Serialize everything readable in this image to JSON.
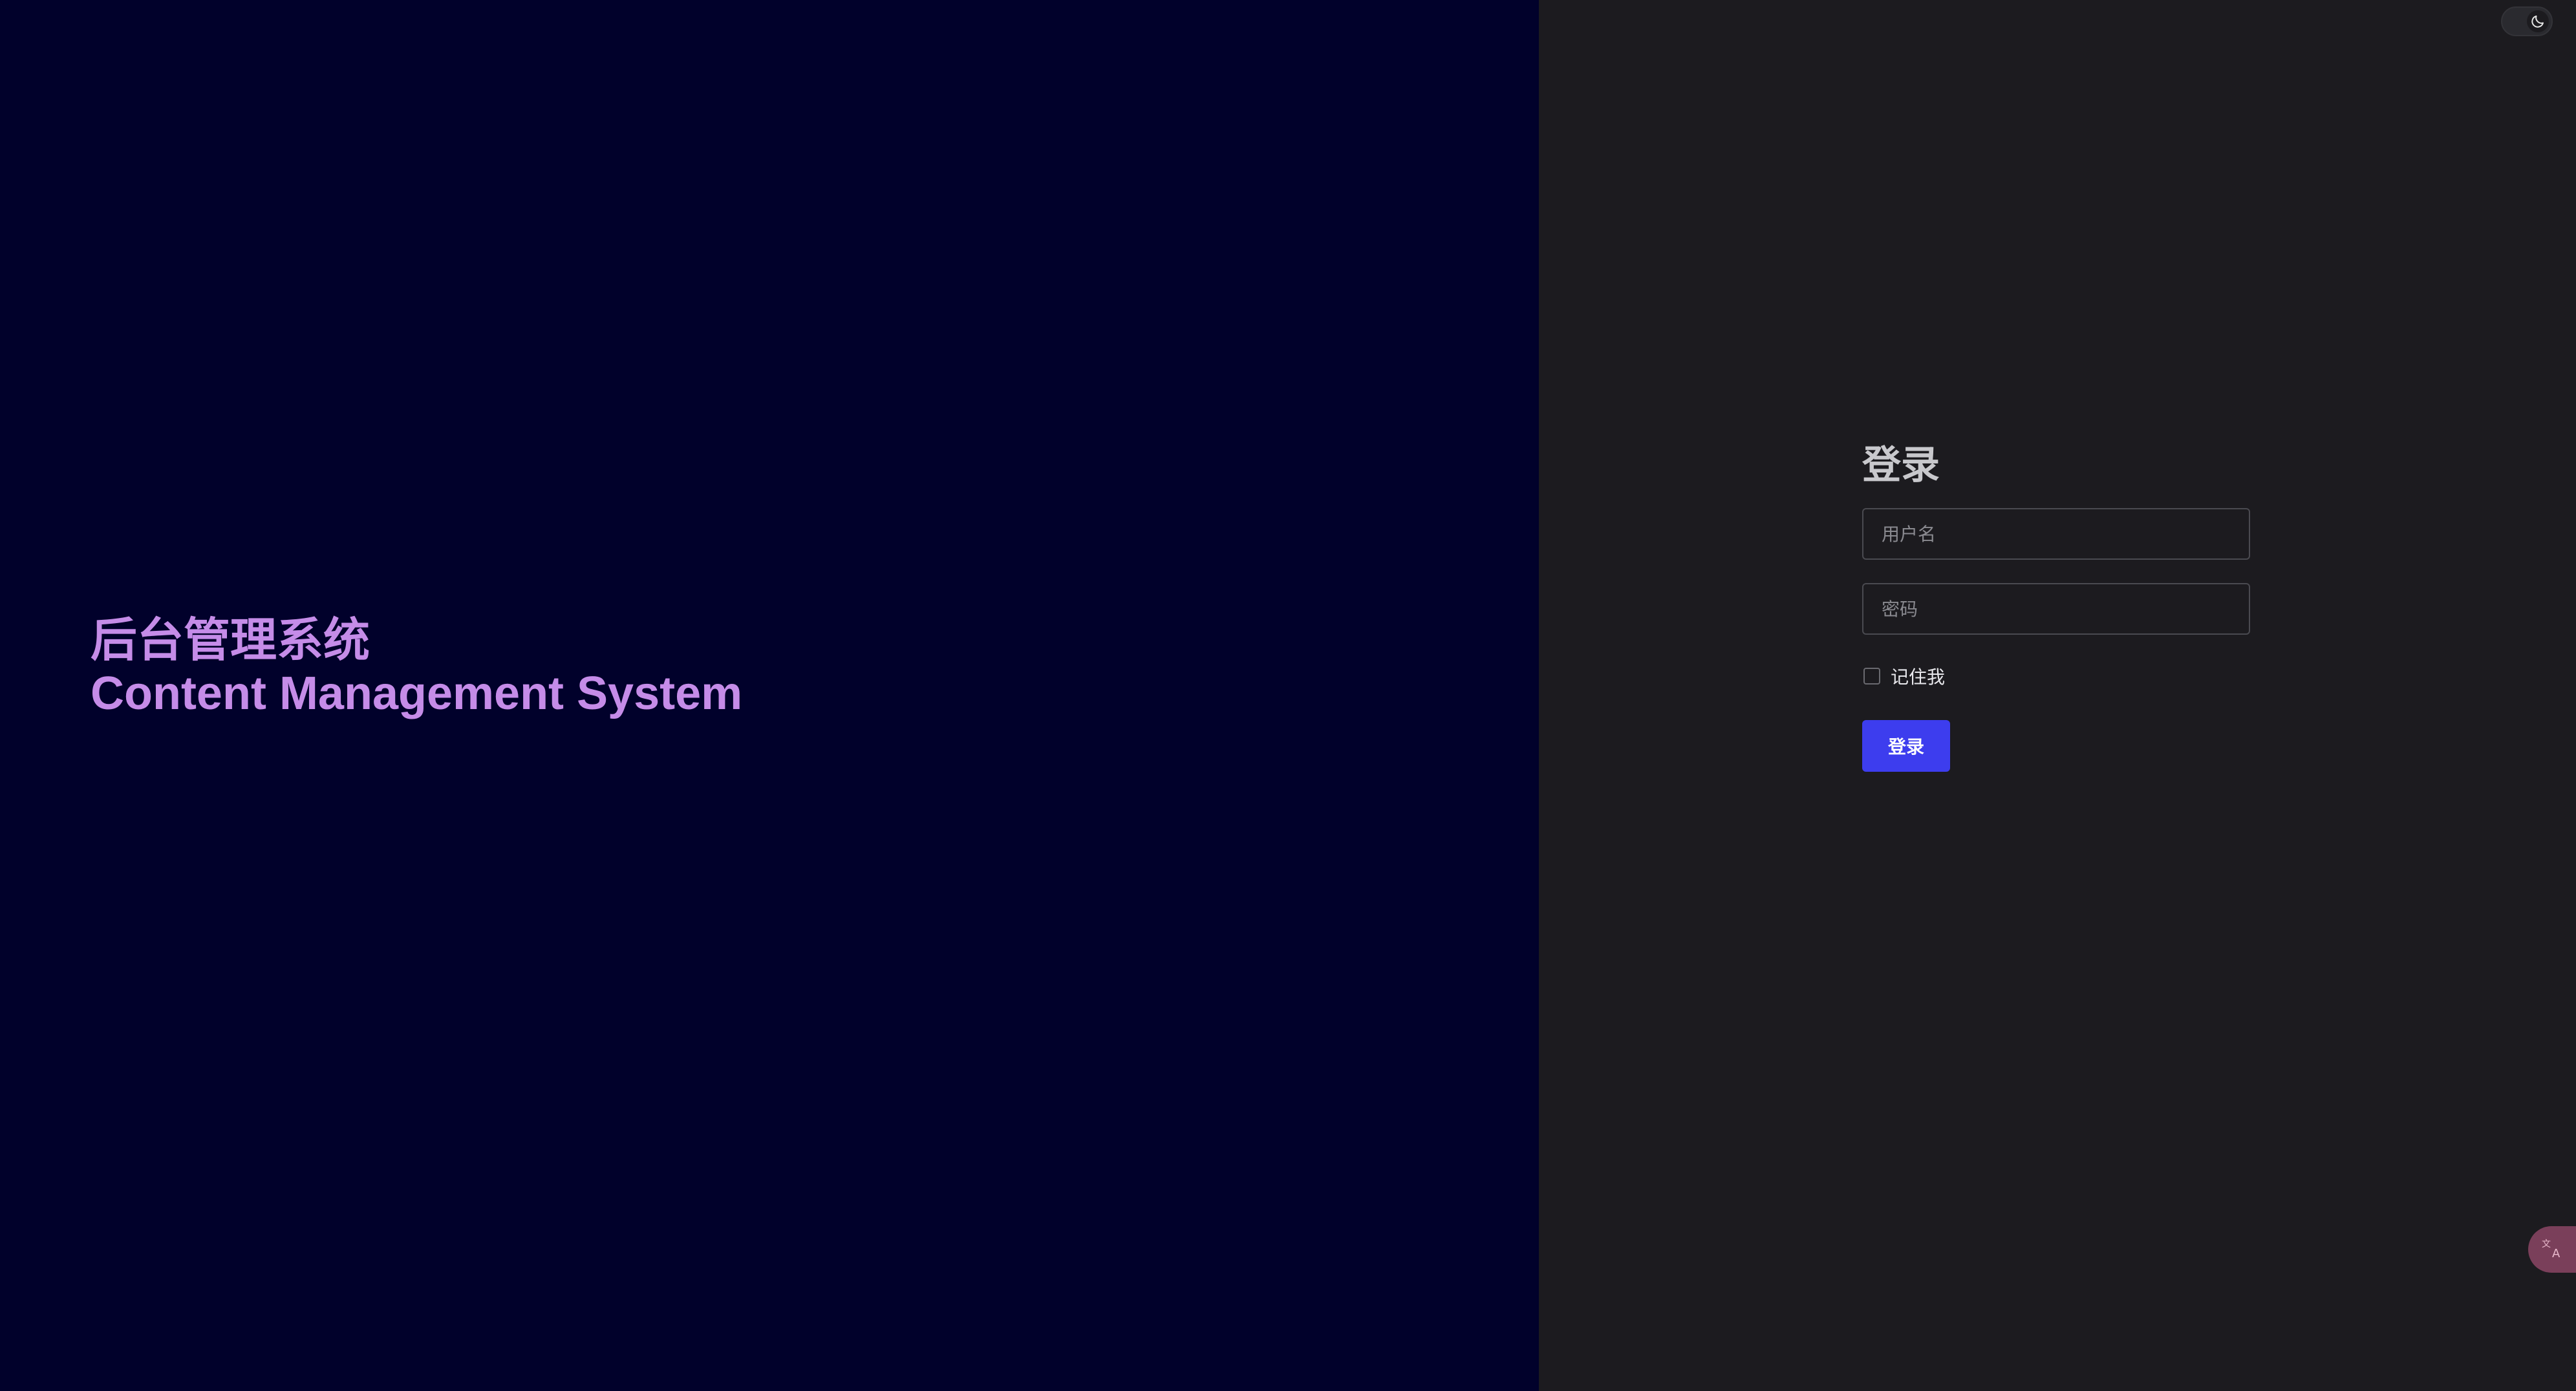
{
  "hero": {
    "title_cn": "后台管理系统",
    "title_en": "Content Management System"
  },
  "login": {
    "heading": "登录",
    "username_placeholder": "用户名",
    "password_placeholder": "密码",
    "remember_label": "记住我",
    "submit_label": "登录"
  },
  "toolbar": {
    "theme_icon": "moon-icon",
    "translate_icon": "translate-icon"
  },
  "colors": {
    "hero_bg": "#01012b",
    "hero_text": "#c58ce8",
    "panel_bg": "#1c1b1f",
    "primary_button": "#3d3dee"
  }
}
